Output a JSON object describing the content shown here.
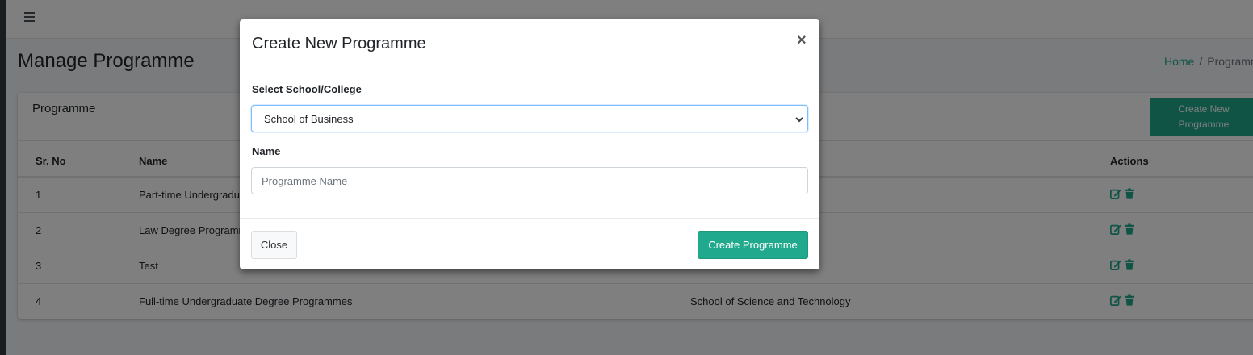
{
  "page": {
    "title": "Manage Programme"
  },
  "breadcrumb": {
    "home": "Home",
    "separator": "/",
    "current": "Programme"
  },
  "card": {
    "title": "Programme",
    "create_button_line1": "Create New",
    "create_button_line2": "Programme"
  },
  "table": {
    "headers": [
      "Sr. No",
      "Name",
      "",
      "Actions"
    ],
    "rows": [
      {
        "sr": "1",
        "name": "Part-time Undergraduate Degree Programmes",
        "school": ""
      },
      {
        "sr": "2",
        "name": "Law Degree Programmes",
        "school": ""
      },
      {
        "sr": "3",
        "name": "Test",
        "school": ""
      },
      {
        "sr": "4",
        "name": "Full-time Undergraduate Degree Programmes",
        "school": "School of Science and Technology"
      }
    ],
    "action_icons": [
      "edit-icon",
      "trash-icon"
    ]
  },
  "modal": {
    "title": "Create New Programme",
    "close_symbol": "×",
    "school_label": "Select School/College",
    "school_selected": "School of Business",
    "name_label": "Name",
    "name_placeholder": "Programme Name",
    "name_value": "",
    "close_button": "Close",
    "submit_button": "Create Programme"
  },
  "colors": {
    "accent": "#20a98c",
    "sidebar": "#343a40",
    "backdrop": "rgba(0,0,0,0.5)"
  }
}
